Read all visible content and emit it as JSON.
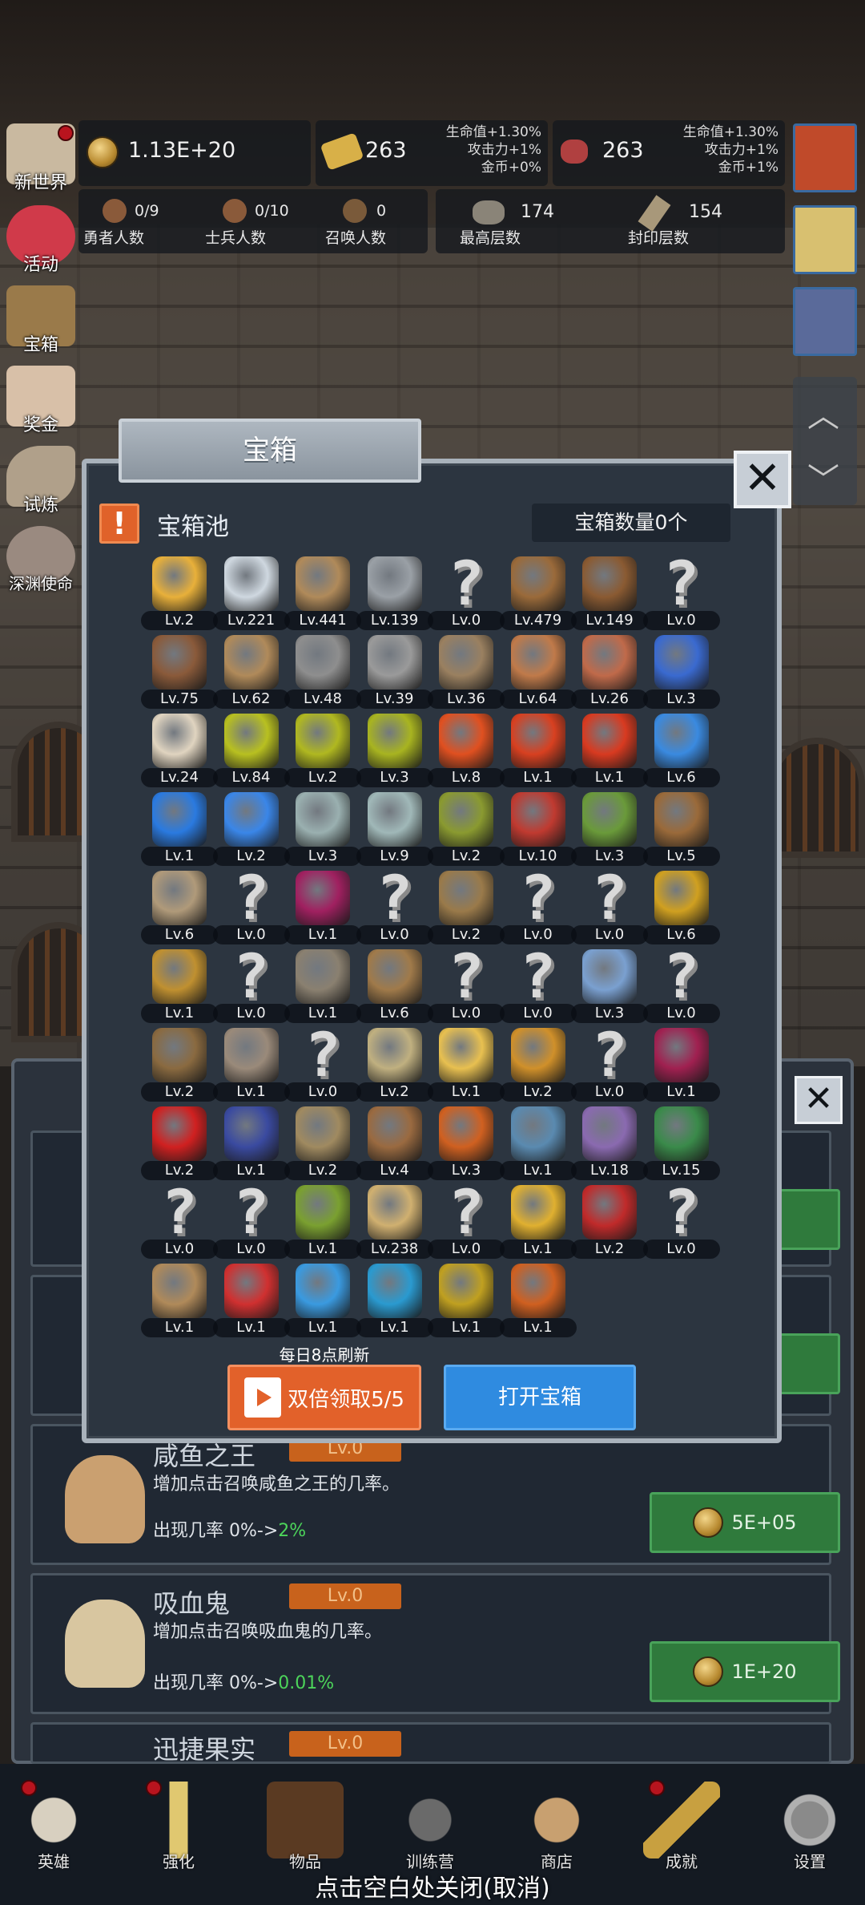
{
  "top": {
    "gold": "1.13E+20",
    "scroll_count": "263",
    "meat_count": "263",
    "bonus1": [
      "生命值+1.30%",
      "攻击力+1%",
      "金币+0%"
    ],
    "bonus2": [
      "生命值+1.30%",
      "攻击力+1%",
      "金币+1%"
    ],
    "heroes": {
      "value": "0/9",
      "label": "勇者人数"
    },
    "soldiers": {
      "value": "0/10",
      "label": "士兵人数"
    },
    "summons": {
      "value": "0",
      "label": "召唤人数"
    },
    "max_floor": {
      "value": "174",
      "label": "最高层数"
    },
    "seal_floor": {
      "value": "154",
      "label": "封印层数"
    }
  },
  "sidebar": [
    "新世界",
    "活动",
    "宝箱",
    "奖金",
    "试炼",
    "深渊使命"
  ],
  "modal": {
    "title": "宝箱",
    "pool_title": "宝箱池",
    "chest_count": "宝箱数量0个",
    "refresh_note": "每日8点刷新",
    "double_button": "双倍领取5/5",
    "open_button": "打开宝箱",
    "items": [
      {
        "icon": "crown-icon",
        "lv": "Lv.2",
        "c": "#e8b03a"
      },
      {
        "icon": "diamond-icon",
        "lv": "Lv.221",
        "c": "#cfd8e0"
      },
      {
        "icon": "sword-icon",
        "lv": "Lv.441",
        "c": "#b08a5a"
      },
      {
        "icon": "sword-icon",
        "lv": "Lv.139",
        "c": "#9aa0a6"
      },
      {
        "icon": "unknown-icon",
        "lv": "Lv.0",
        "q": true
      },
      {
        "icon": "armor-icon",
        "lv": "Lv.479",
        "c": "#9a6a3a"
      },
      {
        "icon": "backpack-icon",
        "lv": "Lv.149",
        "c": "#8a5a32"
      },
      {
        "icon": "unknown-icon",
        "lv": "Lv.0",
        "q": true
      },
      {
        "icon": "helmet-icon",
        "lv": "Lv.75",
        "c": "#8a5a3a"
      },
      {
        "icon": "dagger-icon",
        "lv": "Lv.62",
        "c": "#b08a5a"
      },
      {
        "icon": "knight-helmet-icon",
        "lv": "Lv.48",
        "c": "#8e8e8e"
      },
      {
        "icon": "hammer-icon",
        "lv": "Lv.39",
        "c": "#9a9a9a"
      },
      {
        "icon": "great-helm-icon",
        "lv": "Lv.36",
        "c": "#9a8060"
      },
      {
        "icon": "meat-icon",
        "lv": "Lv.64",
        "c": "#c07a4a"
      },
      {
        "icon": "steak-icon",
        "lv": "Lv.26",
        "c": "#c06a4a"
      },
      {
        "icon": "pouch-icon",
        "lv": "Lv.3",
        "c": "#3a6ad0"
      },
      {
        "icon": "bread-icon",
        "lv": "Lv.24",
        "c": "#e0d4c0"
      },
      {
        "icon": "potion-yellow-icon",
        "lv": "Lv.84",
        "c": "#b8c020"
      },
      {
        "icon": "potion-yellow-icon",
        "lv": "Lv.2",
        "c": "#b0b820"
      },
      {
        "icon": "potion-yellow-icon",
        "lv": "Lv.3",
        "c": "#a8b420"
      },
      {
        "icon": "potion-red-icon",
        "lv": "Lv.8",
        "c": "#e05020"
      },
      {
        "icon": "potion-red-icon",
        "lv": "Lv.1",
        "c": "#d84020"
      },
      {
        "icon": "potion-red-icon",
        "lv": "Lv.1",
        "c": "#d83a20"
      },
      {
        "icon": "potion-blue-icon",
        "lv": "Lv.6",
        "c": "#3a8ae0"
      },
      {
        "icon": "potion-blue-icon",
        "lv": "Lv.1",
        "c": "#2a7ae0"
      },
      {
        "icon": "potion-blue-icon",
        "lv": "Lv.2",
        "c": "#3a86e8"
      },
      {
        "icon": "vial-icon",
        "lv": "Lv.3",
        "c": "#9ab0b0"
      },
      {
        "icon": "vial-icon",
        "lv": "Lv.9",
        "c": "#a0b8b8"
      },
      {
        "icon": "bottle-green-icon",
        "lv": "Lv.2",
        "c": "#8a9a30"
      },
      {
        "icon": "bottle-red-icon",
        "lv": "Lv.10",
        "c": "#c03a30"
      },
      {
        "icon": "winged-boot-icon",
        "lv": "Lv.3",
        "c": "#6a9a3a"
      },
      {
        "icon": "boot-icon",
        "lv": "Lv.5",
        "c": "#9a6a3a"
      },
      {
        "icon": "boot-icon",
        "lv": "Lv.6",
        "c": "#b09a7a"
      },
      {
        "icon": "unknown-icon",
        "lv": "Lv.0",
        "q": true
      },
      {
        "icon": "magic-boot-icon",
        "lv": "Lv.1",
        "c": "#a02060"
      },
      {
        "icon": "unknown-icon",
        "lv": "Lv.0",
        "q": true
      },
      {
        "icon": "staff-icon",
        "lv": "Lv.2",
        "c": "#9a7a4a"
      },
      {
        "icon": "unknown-icon",
        "lv": "Lv.0",
        "q": true
      },
      {
        "icon": "unknown-icon",
        "lv": "Lv.0",
        "q": true
      },
      {
        "icon": "torch-icon",
        "lv": "Lv.6",
        "c": "#d0a020"
      },
      {
        "icon": "torch-icon",
        "lv": "Lv.1",
        "c": "#c09030"
      },
      {
        "icon": "unknown-icon",
        "lv": "Lv.0",
        "q": true
      },
      {
        "icon": "pickaxe-icon",
        "lv": "Lv.1",
        "c": "#8a8070"
      },
      {
        "icon": "cane-icon",
        "lv": "Lv.6",
        "c": "#a07a4a"
      },
      {
        "icon": "unknown-icon",
        "lv": "Lv.0",
        "q": true
      },
      {
        "icon": "unknown-icon",
        "lv": "Lv.0",
        "q": true
      },
      {
        "icon": "wand-icon",
        "lv": "Lv.3",
        "c": "#7aa0d0"
      },
      {
        "icon": "unknown-icon",
        "lv": "Lv.0",
        "q": true
      },
      {
        "icon": "backpack-icon",
        "lv": "Lv.2",
        "c": "#8a6a40"
      },
      {
        "icon": "shovel-icon",
        "lv": "Lv.1",
        "c": "#9a8a7a"
      },
      {
        "icon": "unknown-icon",
        "lv": "Lv.0",
        "q": true
      },
      {
        "icon": "club-icon",
        "lv": "Lv.2",
        "c": "#c0b080"
      },
      {
        "icon": "cheese-icon",
        "lv": "Lv.1",
        "c": "#e8c050"
      },
      {
        "icon": "pie-icon",
        "lv": "Lv.2",
        "c": "#d0902a"
      },
      {
        "icon": "unknown-icon",
        "lv": "Lv.0",
        "q": true
      },
      {
        "icon": "crystal-icon",
        "lv": "Lv.1",
        "c": "#a02050"
      },
      {
        "icon": "orb-red-icon",
        "lv": "Lv.2",
        "c": "#d02020"
      },
      {
        "icon": "gem-orb-icon",
        "lv": "Lv.1",
        "c": "#3a4aa0"
      },
      {
        "icon": "bow-icon",
        "lv": "Lv.2",
        "c": "#a08a60"
      },
      {
        "icon": "quiver-icon",
        "lv": "Lv.4",
        "c": "#9a6a40"
      },
      {
        "icon": "gauntlet-icon",
        "lv": "Lv.3",
        "c": "#d06020"
      },
      {
        "icon": "relic-blue-icon",
        "lv": "Lv.1",
        "c": "#5a8ab0"
      },
      {
        "icon": "relic-purple-icon",
        "lv": "Lv.18",
        "c": "#8a6ab0"
      },
      {
        "icon": "amulet-icon",
        "lv": "Lv.15",
        "c": "#3a8a4a"
      },
      {
        "icon": "unknown-icon",
        "lv": "Lv.0",
        "q": true
      },
      {
        "icon": "unknown-icon",
        "lv": "Lv.0",
        "q": true
      },
      {
        "icon": "scepter-icon",
        "lv": "Lv.1",
        "c": "#7aa030"
      },
      {
        "icon": "beer-mug-icon",
        "lv": "Lv.238",
        "c": "#d0b070"
      },
      {
        "icon": "unknown-icon",
        "lv": "Lv.0",
        "q": true
      },
      {
        "icon": "golden-pickaxe-icon",
        "lv": "Lv.1",
        "c": "#e0b030"
      },
      {
        "icon": "red-book-icon",
        "lv": "Lv.2",
        "c": "#c02a2a"
      },
      {
        "icon": "unknown-icon",
        "lv": "Lv.0",
        "q": true
      },
      {
        "icon": "whip-icon",
        "lv": "Lv.1",
        "c": "#b08a5a"
      },
      {
        "icon": "red-card-icon",
        "lv": "Lv.1",
        "c": "#d03030"
      },
      {
        "icon": "crystal-ball-icon",
        "lv": "Lv.1",
        "c": "#3a9ae0"
      },
      {
        "icon": "rune-circle-icon",
        "lv": "Lv.1",
        "c": "#2a9ad0"
      },
      {
        "icon": "gold-orb-icon",
        "lv": "Lv.1",
        "c": "#c0a020"
      },
      {
        "icon": "flame-staff-icon",
        "lv": "Lv.1",
        "c": "#d06020"
      }
    ]
  },
  "list": {
    "rows": [
      {
        "name": "咸鱼之王",
        "lv": "Lv.0",
        "desc": "增加点击召唤咸鱼之王的几率。",
        "rate_prefix": "出现几率 0%->",
        "rate_value": "2%",
        "cost": "5E+05"
      },
      {
        "name": "吸血鬼",
        "lv": "Lv.0",
        "desc": "增加点击召唤吸血鬼的几率。",
        "rate_prefix": "出现几率 0%->",
        "rate_value": "0.01%",
        "cost": "1E+20"
      },
      {
        "name": "迅捷果实",
        "lv": "Lv.0"
      }
    ]
  },
  "nav": [
    "英雄",
    "强化",
    "物品",
    "训练营",
    "商店",
    "成就",
    "设置"
  ],
  "close_hint": "点击空白处关闭(取消)"
}
